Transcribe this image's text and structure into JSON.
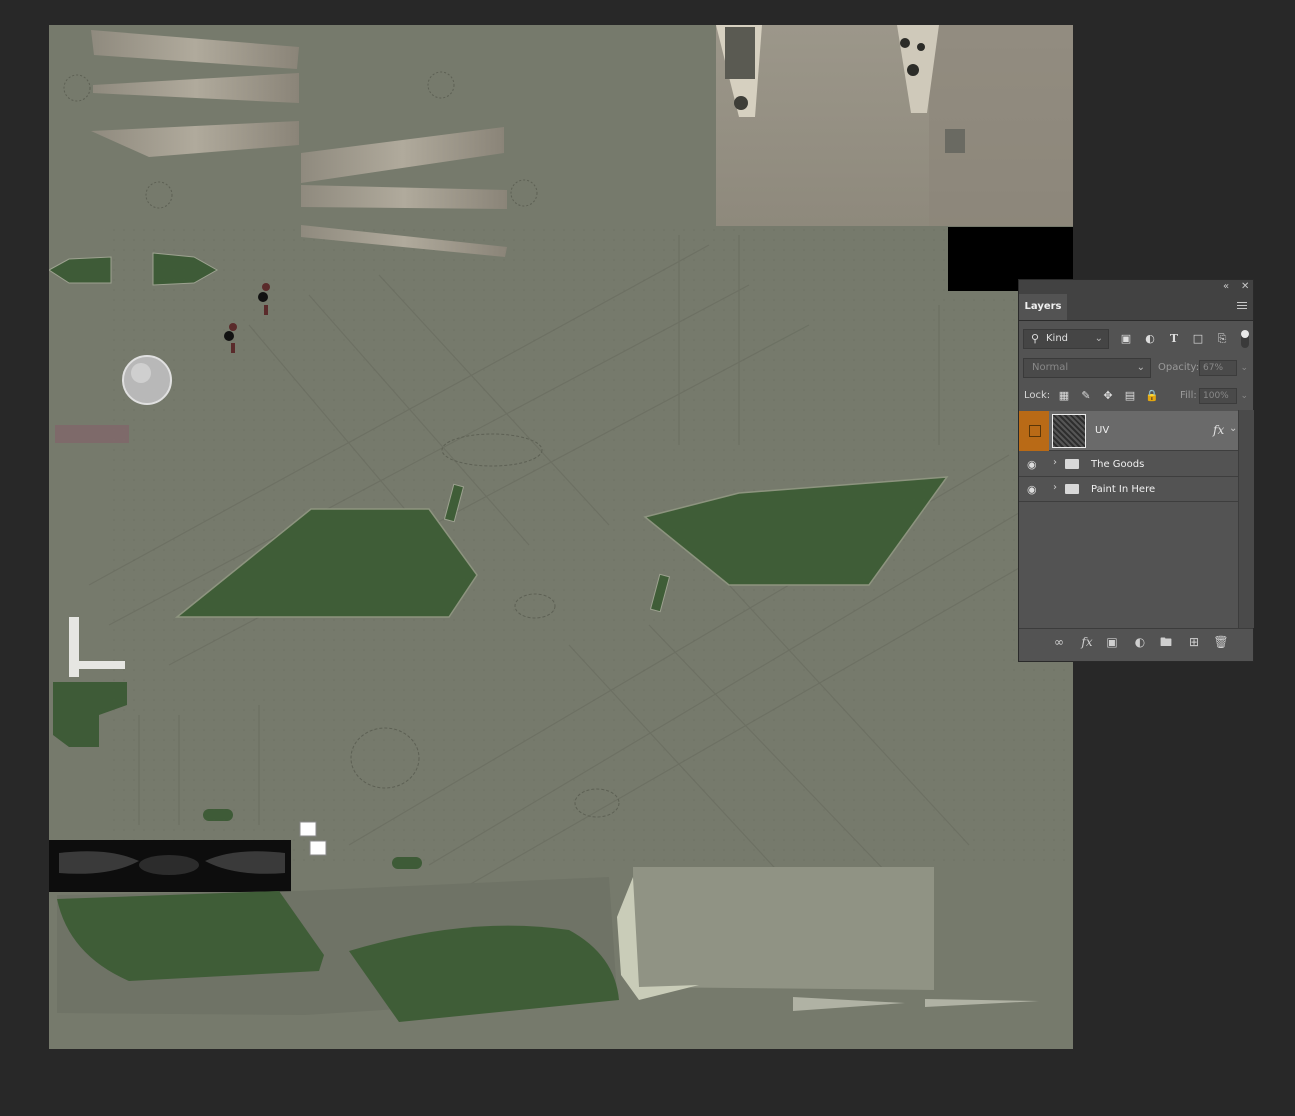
{
  "panel": {
    "collapse_icon": "double-chevron-left-icon",
    "close_icon": "close-icon",
    "tab_label": "Layers",
    "menu_icon": "panel-menu-icon"
  },
  "filter": {
    "kind_label": "Kind",
    "icons": [
      "image-filter-icon",
      "adjustment-filter-icon",
      "type-filter-icon",
      "shape-filter-icon",
      "smart-object-filter-icon"
    ]
  },
  "blend": {
    "mode": "Normal",
    "opacity_label": "Opacity:",
    "opacity_value": "67%"
  },
  "lock": {
    "label": "Lock:",
    "fill_label": "Fill:",
    "fill_value": "100%"
  },
  "layers": [
    {
      "name": "UV",
      "type": "layer",
      "selected": true,
      "visible": false,
      "fx": "fx"
    },
    {
      "name": "The Goods",
      "type": "group",
      "selected": false,
      "visible": true
    },
    {
      "name": "Paint In Here",
      "type": "group",
      "selected": false,
      "visible": true
    }
  ],
  "colors": {
    "app_bg": "#282828",
    "panel_bg": "#535353",
    "canvas_base": "#767a6c",
    "green_paint": "#3b5a34",
    "selected_accent": "#b96a16"
  }
}
